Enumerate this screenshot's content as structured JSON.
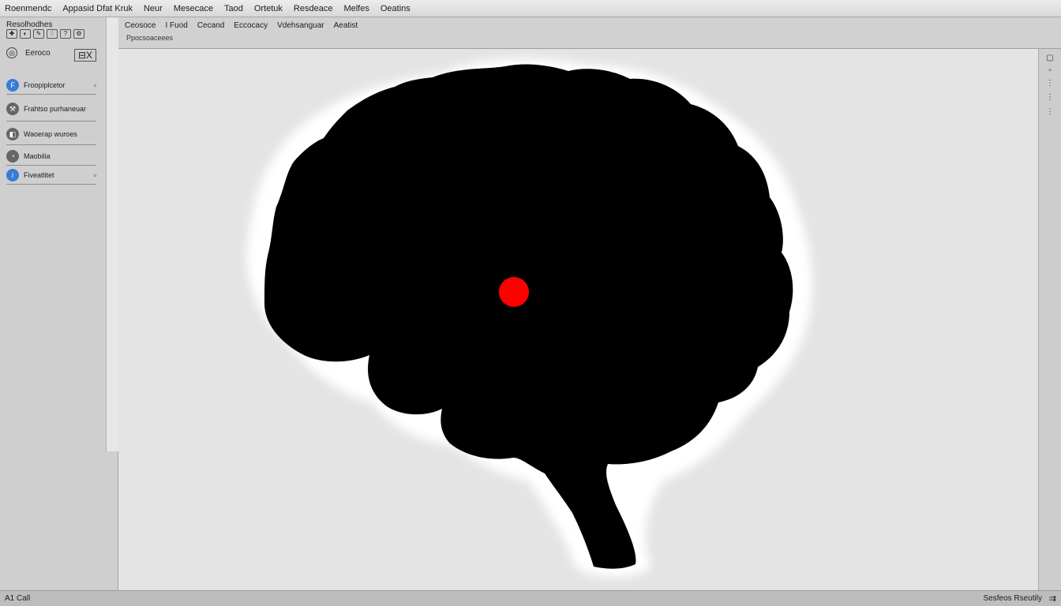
{
  "menu": {
    "items": [
      "Roenmendc",
      "Appasid Dfat Kruk",
      "Neur",
      "Mesecace",
      "Taod",
      "Ortetuk",
      "Resdeace",
      "Melfes",
      "Oeatins"
    ]
  },
  "left_panel": {
    "title": "Resolhodhes",
    "sub_label": "Eeroco",
    "close_label": "⊟X",
    "toolbar_icons": [
      "✚",
      "◐",
      "✎",
      "♢",
      "?",
      "⚙"
    ],
    "items": [
      {
        "label": "Froopiplcetor",
        "expand": "▫"
      },
      {
        "label": "Frahtso purhaneuar",
        "expand": ""
      },
      {
        "label": "Waoerap wuroes",
        "expand": ""
      },
      {
        "label": "Maobilia",
        "expand": ""
      },
      {
        "label": "Fiveatlitet",
        "expand": "▫"
      }
    ]
  },
  "subtoolbar": {
    "tabs": [
      "Ceosoce",
      "I Fuod",
      "Cecand",
      "Eccocacy",
      "Vdehsanguar",
      "Aeatist"
    ],
    "breadcrumb": "Ppocsoaceees"
  },
  "status": {
    "left": "A1 Call",
    "right": "Sesfeos Rseutily",
    "icon": "⇉"
  },
  "colors": {
    "brain": "#000000",
    "marker": "#ff0000",
    "halo": "#ffffff",
    "accent": "#3a7bd5"
  }
}
